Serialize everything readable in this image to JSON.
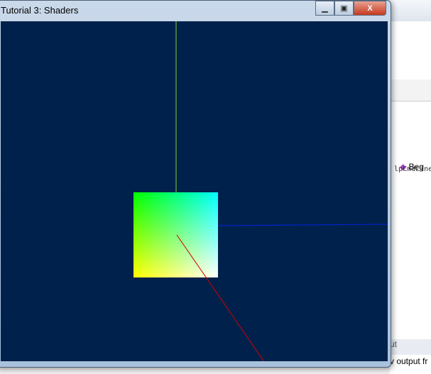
{
  "window": {
    "title": "Tutorial 3: Shaders",
    "minimize": "▁",
    "maximize": "▣",
    "close": "X"
  },
  "ide": {
    "toolbar_item": "Beg",
    "code_text": "lpCmdLine",
    "output_tab": "ut",
    "output_text": "v output fr"
  },
  "scene": {
    "background": "#00214b",
    "axis_y_color": "#7fd03a",
    "axis_x_color": "#0022cc",
    "axis_z_color": "#cc0000",
    "quad_corners": {
      "top_left": "#00ff00",
      "top_right": "#00ffff",
      "bottom_left": "#ffff00",
      "bottom_right": "#ffffff"
    }
  }
}
